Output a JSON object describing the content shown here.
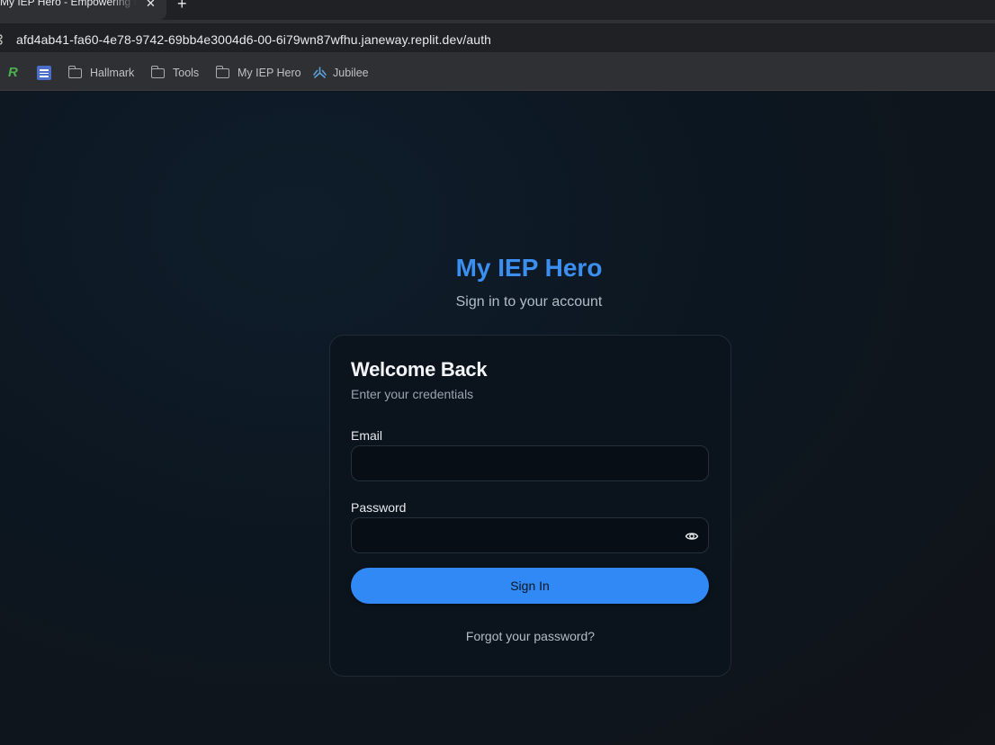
{
  "browser": {
    "tab_title": "My IEP Hero - Empowering Parents",
    "tab_close": "✕",
    "new_tab": "+",
    "url": "afd4ab41-fa60-4e78-9742-69bb4e3004d6-00-6i79wn87wfhu.janeway.replit.dev/auth",
    "bookmarks": [
      {
        "label": "Hallmark",
        "icon": "folder-icon"
      },
      {
        "label": "Tools",
        "icon": "folder-icon"
      },
      {
        "label": "My IEP Hero",
        "icon": "folder-icon"
      },
      {
        "label": "Jubilee",
        "icon": "jubilee-icon"
      }
    ]
  },
  "page": {
    "brand": "My IEP Hero",
    "subtitle": "Sign in to your account",
    "card": {
      "title": "Welcome Back",
      "description": "Enter your credentials",
      "email_label": "Email",
      "email_value": "",
      "password_label": "Password",
      "password_value": "",
      "signin_label": "Sign In",
      "forgot_label": "Forgot your password?"
    }
  },
  "colors": {
    "accent": "#3189f5",
    "brand": "#3b8ff0",
    "background": "#0c131b"
  }
}
